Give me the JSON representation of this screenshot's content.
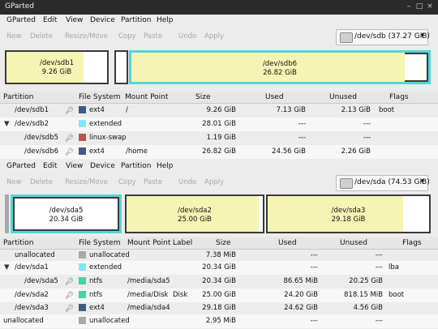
{
  "window": {
    "title": "GParted",
    "controls": [
      "–",
      "□",
      "×"
    ]
  },
  "menu": [
    "GParted",
    "Edit",
    "View",
    "Device",
    "Partition",
    "Help"
  ],
  "toolbar": [
    "New",
    "Delete",
    "Resize/Move",
    "Copy",
    "Paste",
    "Undo",
    "Apply"
  ],
  "colors": {
    "ext4": "#3e5c83",
    "extended": "#7ee8ff",
    "linux_swap": "#c0504d",
    "ntfs": "#41d69c",
    "unallocated": "#a8a8a8",
    "used_fill": "#f6f4b4",
    "selected": "#4fd7d7",
    "border_dark": "#3a3a3a"
  },
  "panel1": {
    "device": "/dev/sdb  (37.27 GiB)",
    "map": [
      {
        "name": "/dev/sdb1",
        "size": "9.26 GiB",
        "used_ratio": 0.77
      },
      {
        "name": "",
        "size": "",
        "used_ratio": 0.0
      },
      {
        "name": "/dev/sdb6",
        "size": "26.82 GiB",
        "used_ratio": 0.92
      }
    ],
    "headers": [
      "Partition",
      "File System",
      "Mount Point",
      "Size",
      "Used",
      "Unused",
      "Flags"
    ],
    "rows": [
      {
        "partition": "/dev/sdb1",
        "fs": "ext4",
        "fs_color": "#3e5c83",
        "mount": "/",
        "label": "",
        "size": "9.26 GiB",
        "used": "7.13 GiB",
        "unused": "2.13 GiB",
        "flags": "boot"
      },
      {
        "partition": "/dev/sdb2",
        "fs": "extended",
        "fs_color": "#7ee8ff",
        "mount": "",
        "label": "",
        "size": "28.01 GiB",
        "used": "---",
        "unused": "---",
        "flags": ""
      },
      {
        "partition": "/dev/sdb5",
        "fs": "linux-swap",
        "fs_color": "#c0504d",
        "mount": "",
        "label": "",
        "size": "1.19 GiB",
        "used": "---",
        "unused": "---",
        "flags": ""
      },
      {
        "partition": "/dev/sdb6",
        "fs": "ext4",
        "fs_color": "#3e5c83",
        "mount": "/home",
        "label": "",
        "size": "26.82 GiB",
        "used": "24.56 GiB",
        "unused": "2.26 GiB",
        "flags": ""
      }
    ]
  },
  "panel2": {
    "device": "/dev/sda  (74.53 GiB)",
    "map": [
      {
        "name": "/dev/sda5",
        "size": "20.34 GiB",
        "used_ratio": 0.0
      },
      {
        "name": "/dev/sda2",
        "size": "25.00 GiB",
        "used_ratio": 0.97
      },
      {
        "name": "/dev/sda3",
        "size": "29.18 GiB",
        "used_ratio": 0.84
      }
    ],
    "headers": [
      "Partition",
      "File System",
      "Mount Point",
      "Label",
      "Size",
      "Used",
      "Unused",
      "Flags"
    ],
    "rows": [
      {
        "partition": "unallocated",
        "fs": "unallocated",
        "fs_color": "#a8a8a8",
        "mount": "",
        "label": "",
        "size": "7.38 MiB",
        "used": "---",
        "unused": "---",
        "flags": ""
      },
      {
        "partition": "/dev/sda1",
        "fs": "extended",
        "fs_color": "#7ee8ff",
        "mount": "",
        "label": "",
        "size": "20.34 GiB",
        "used": "---",
        "unused": "---",
        "flags": "lba"
      },
      {
        "partition": "/dev/sda5",
        "fs": "ntfs",
        "fs_color": "#41d69c",
        "mount": "/media/sda5",
        "label": "",
        "size": "20.34 GiB",
        "used": "86.65 MiB",
        "unused": "20.25 GiB",
        "flags": ""
      },
      {
        "partition": "/dev/sda2",
        "fs": "ntfs",
        "fs_color": "#41d69c",
        "mount": "/media/Disk",
        "label": "Disk",
        "size": "25.00 GiB",
        "used": "24.20 GiB",
        "unused": "818.15 MiB",
        "flags": "boot"
      },
      {
        "partition": "/dev/sda3",
        "fs": "ext4",
        "fs_color": "#3e5c83",
        "mount": "/media/sda4",
        "label": "",
        "size": "29.18 GiB",
        "used": "24.62 GiB",
        "unused": "4.56 GiB",
        "flags": ""
      },
      {
        "partition": "unallocated",
        "fs": "unallocated",
        "fs_color": "#a8a8a8",
        "mount": "",
        "label": "",
        "size": "2.95 MiB",
        "used": "---",
        "unused": "---",
        "flags": ""
      }
    ]
  }
}
